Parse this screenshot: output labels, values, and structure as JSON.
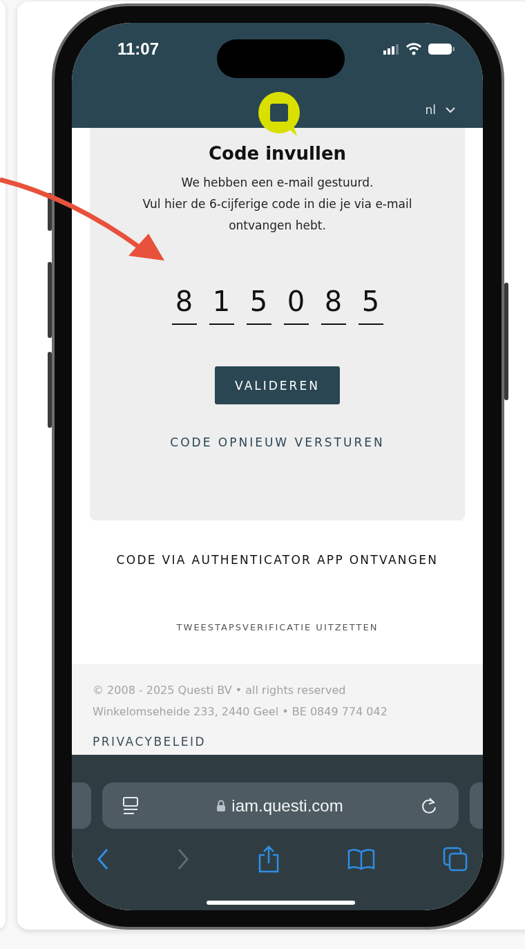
{
  "status_bar": {
    "time": "11:07"
  },
  "header": {
    "language": "nl"
  },
  "card": {
    "title": "Code invullen",
    "message": [
      "We hebben een e-mail gestuurd.",
      "Vul hier de 6-cijferige code in die je via e-mail ontvangen hebt."
    ],
    "code_digits": [
      "8",
      "1",
      "5",
      "0",
      "8",
      "5"
    ],
    "submit_button": "VALIDEREN",
    "resend_link": "CODE OPNIEUW VERSTUREN"
  },
  "links": [
    "CODE VIA AUTHENTICATOR APP ONTVANGEN",
    "TWEESTAPSVERIFICATIE UITZETTEN"
  ],
  "footer": {
    "copyright": "© 2008 - 2025 Questi BV • all rights reserved",
    "address": "Winkelomseheide 233, 2440 Geel • BE 0849 774 042",
    "privacy_link": "PRIVACYBELEID"
  },
  "browser": {
    "url": "iam.questi.com",
    "toolbar": [
      {
        "kind": "back",
        "disabled": false
      },
      {
        "kind": "forward",
        "disabled": true
      },
      {
        "kind": "share",
        "disabled": false
      },
      {
        "kind": "bookmarks",
        "disabled": false
      },
      {
        "kind": "tabs",
        "disabled": false
      }
    ]
  }
}
